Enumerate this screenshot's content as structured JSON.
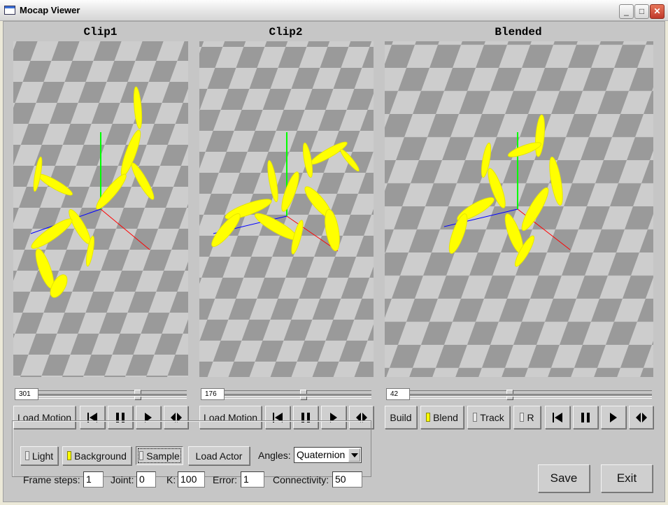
{
  "window": {
    "title": "Mocap Viewer"
  },
  "views": [
    {
      "label": "Clip1",
      "frame": "301",
      "slider_fraction": 0.68
    },
    {
      "label": "Clip2",
      "frame": "176",
      "slider_fraction": 0.54
    },
    {
      "label": "Blended",
      "frame": "42",
      "slider_fraction": 0.41
    }
  ],
  "controls": {
    "load_motion": "Load Motion",
    "build": "Build",
    "blend": "Blend",
    "track": "Track",
    "r": "R"
  },
  "options": {
    "light": "Light",
    "background": "Background",
    "sample": "Sample",
    "load_actor": "Load Actor",
    "angles_label": "Angles:",
    "angles_value": "Quaternion",
    "frame_steps_label": "Frame steps:",
    "frame_steps_value": "1",
    "joint_label": "Joint:",
    "joint_value": "0",
    "k_label": "K:",
    "k_value": "100",
    "error_label": "Error:",
    "error_value": "1",
    "connectivity_label": "Connectivity:",
    "connectivity_value": "50"
  },
  "actions": {
    "save": "Save",
    "exit": "Exit"
  },
  "colors": {
    "skeleton": "#ffff00",
    "floor_light": "#cccccc",
    "floor_dark": "#999999",
    "axis_x": "#ff0000",
    "axis_y": "#00ff00",
    "axis_z": "#0000ff"
  }
}
